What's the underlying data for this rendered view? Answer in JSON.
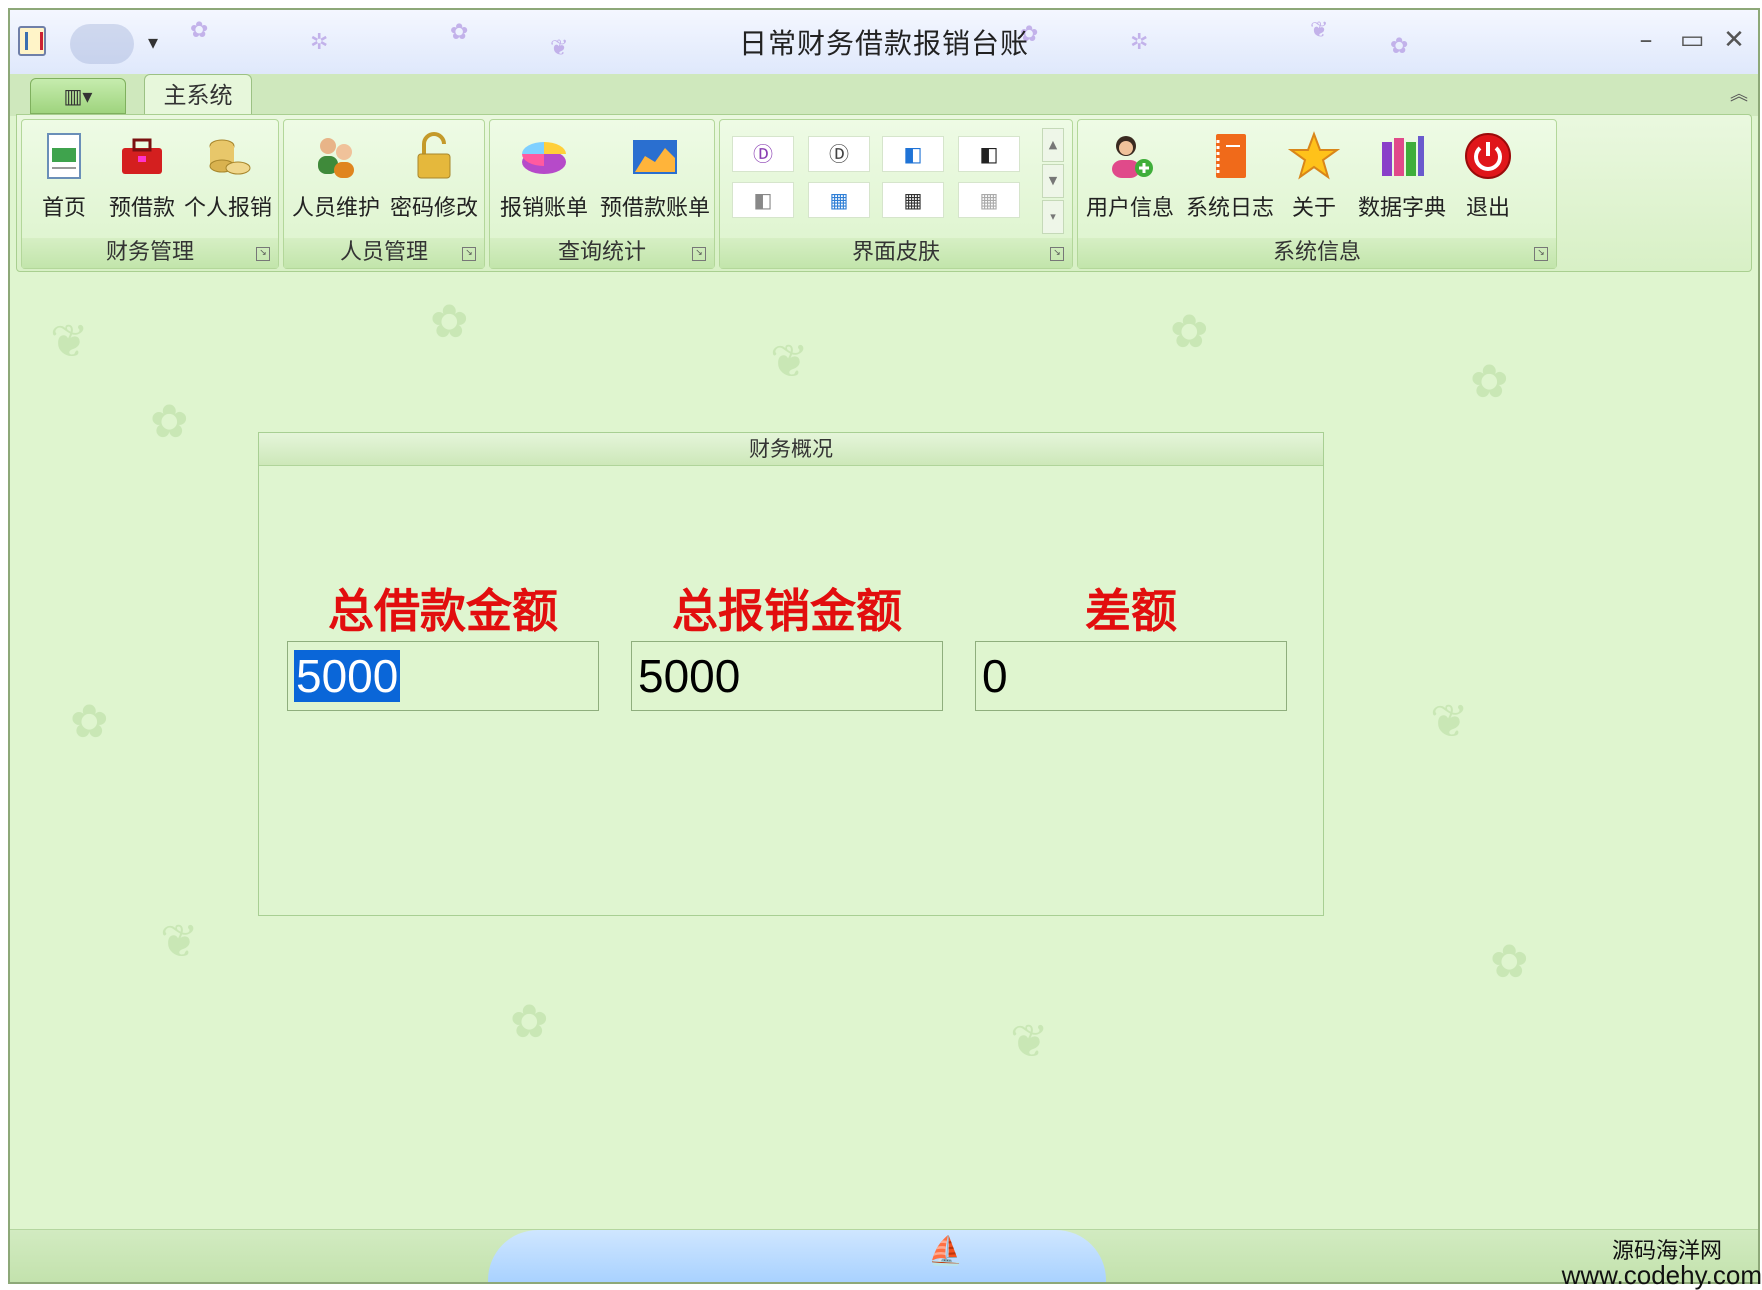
{
  "window": {
    "title": "日常财务借款报销台账",
    "controls": {
      "minimize": "–",
      "maximize": "▭",
      "close": "✕"
    }
  },
  "ribbon": {
    "tabs": [
      {
        "label": "主系统",
        "active": true
      }
    ],
    "groups": {
      "finance": {
        "label": "财务管理",
        "buttons": [
          {
            "label": "首页"
          },
          {
            "label": "预借款"
          },
          {
            "label": "个人报销"
          }
        ]
      },
      "personnel": {
        "label": "人员管理",
        "buttons": [
          {
            "label": "人员维护"
          },
          {
            "label": "密码修改"
          }
        ]
      },
      "query": {
        "label": "查询统计",
        "buttons": [
          {
            "label": "报销账单"
          },
          {
            "label": "预借款账单"
          }
        ]
      },
      "skin": {
        "label": "界面皮肤",
        "items": [
          {
            "icon": "circle-d-icon",
            "glyph": "Ⓓ",
            "color": "#8a3fb3"
          },
          {
            "icon": "circle-d-dark-icon",
            "glyph": "Ⓓ",
            "color": "#444444"
          },
          {
            "icon": "office-blue-icon",
            "glyph": "◧",
            "color": "#1f73d6"
          },
          {
            "icon": "office-black-icon",
            "glyph": "◧",
            "color": "#222222"
          },
          {
            "icon": "office-gray-icon",
            "glyph": "◧",
            "color": "#888888"
          },
          {
            "icon": "metro-blue-icon",
            "glyph": "▦",
            "color": "#2f7fd6"
          },
          {
            "icon": "metro-dark-icon",
            "glyph": "▦",
            "color": "#333333"
          },
          {
            "icon": "metro-light-icon",
            "glyph": "▦",
            "color": "#aaaaaa"
          }
        ]
      },
      "system": {
        "label": "系统信息",
        "buttons": [
          {
            "label": "用户信息"
          },
          {
            "label": "系统日志"
          },
          {
            "label": "关于"
          },
          {
            "label": "数据字典"
          },
          {
            "label": "退出"
          }
        ]
      }
    }
  },
  "overview": {
    "title": "财务概况",
    "fields": [
      {
        "label": "总借款金额",
        "value": "5000"
      },
      {
        "label": "总报销金额",
        "value": "5000"
      },
      {
        "label": "差额",
        "value": "0"
      }
    ]
  },
  "watermark": {
    "line1": "源码海洋网",
    "line2": "www.codehy.com"
  },
  "colors": {
    "accent_red": "#e20e0e",
    "background_green": "#dff5cf",
    "selection_blue": "#0a66d8"
  }
}
